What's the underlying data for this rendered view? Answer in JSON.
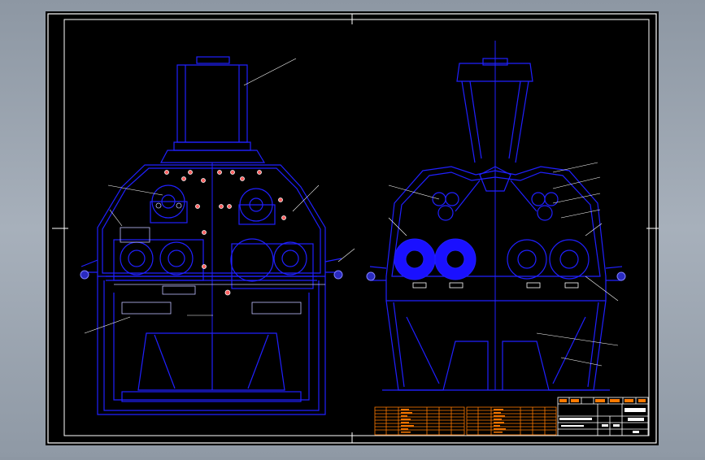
{
  "drawing": {
    "title_block": {
      "drawing_name": "",
      "sheet_label": "",
      "scale_label": ""
    },
    "bom_left_rows": 12,
    "bom_right_rows": 12
  },
  "colors": {
    "background": "#8d97a3",
    "sheet": "#000000",
    "border": "#ffffff",
    "outline": "#2020ff",
    "hatch": "#1a10ff",
    "table": "#ff7a00",
    "label": "#ffffff",
    "detail": "#ffff00",
    "marker": "#ff3030"
  }
}
